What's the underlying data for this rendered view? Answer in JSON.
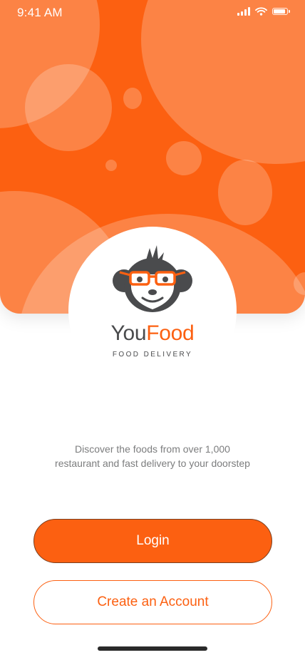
{
  "status_bar": {
    "time": "9:41 AM",
    "icons": [
      "signal-icon",
      "wifi-icon",
      "battery-icon"
    ]
  },
  "brand": {
    "name_part1": "You",
    "name_part2": "Food",
    "tagline": "FOOD DELIVERY",
    "mascot": "monkey-logo-icon"
  },
  "description": {
    "line1": "Discover the foods from over 1,000",
    "line2": "restaurant and fast delivery to your doorstep"
  },
  "actions": {
    "login_label": "Login",
    "create_account_label": "Create an Account"
  },
  "colors": {
    "accent": "#FC6011",
    "text_primary": "#4A4B4D",
    "text_secondary": "#7C7D7E",
    "background": "#FFFFFF"
  }
}
